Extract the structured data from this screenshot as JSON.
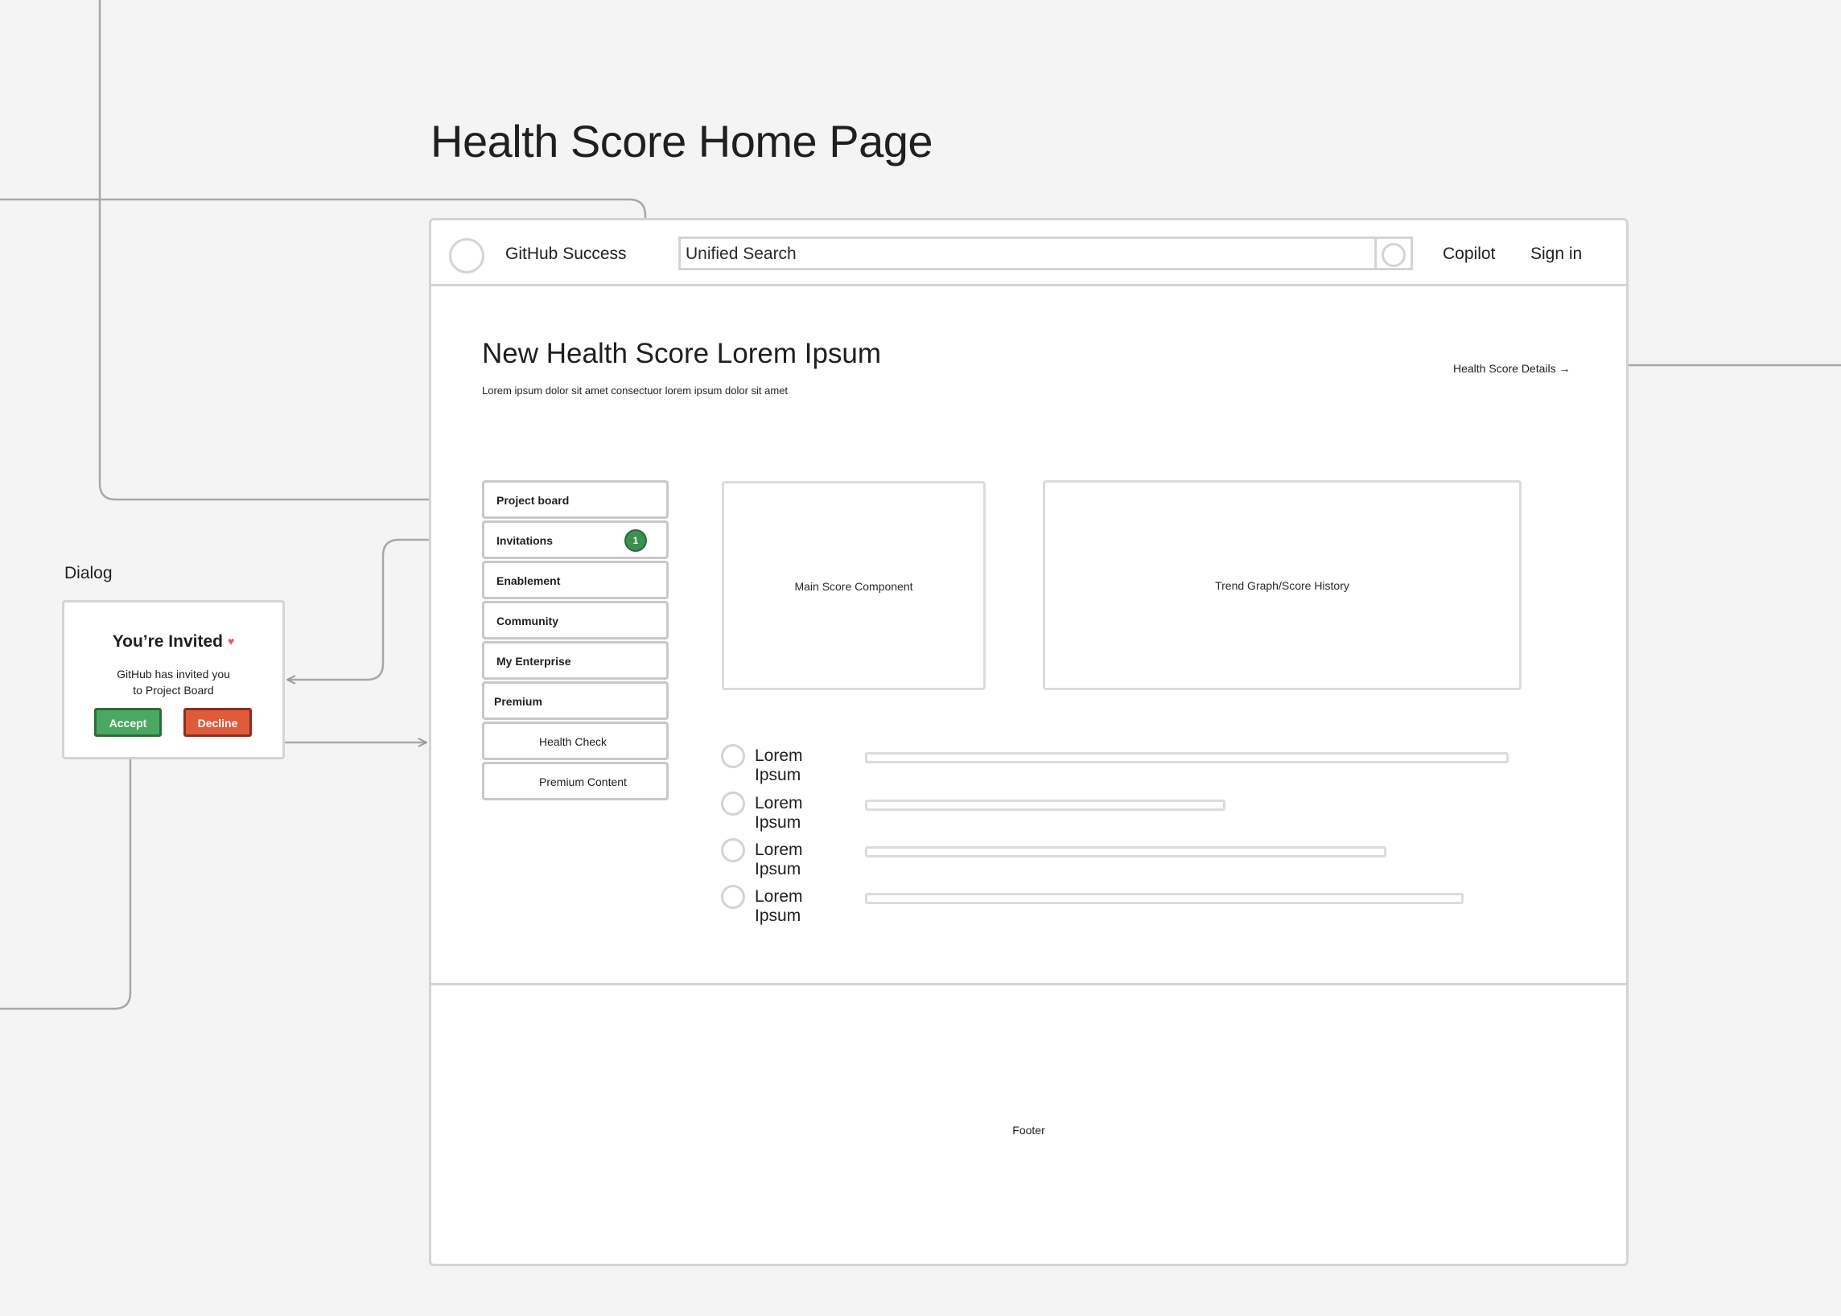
{
  "page_title": "Health Score Home Page",
  "header": {
    "brand": "GitHub Success",
    "search_text": "Unified Search",
    "copilot": "Copilot",
    "sign_in": "Sign in"
  },
  "hero": {
    "title": "New Health Score Lorem Ipsum",
    "subtitle": "Lorem ipsum dolor sit amet consectuor lorem ipsum dolor sit amet",
    "details_link": "Health Score Details →"
  },
  "sidebar": {
    "items": [
      {
        "label": "Project board"
      },
      {
        "label": "Invitations",
        "badge": "1"
      },
      {
        "label": "Enablement"
      },
      {
        "label": "Community"
      },
      {
        "label": "My Enterprise"
      },
      {
        "label": "Premium"
      },
      {
        "label": "Health Check"
      },
      {
        "label": "Premium Content"
      }
    ]
  },
  "cards": {
    "main_score": "Main Score Component",
    "trend_graph": "Trend Graph/Score History"
  },
  "list": [
    {
      "label": "Lorem Ipsum",
      "fill": 1.0
    },
    {
      "label": "Lorem Ipsum",
      "fill": 0.56
    },
    {
      "label": "Lorem Ipsum",
      "fill": 0.81
    },
    {
      "label": "Lorem Ipsum",
      "fill": 0.93
    }
  ],
  "footer": {
    "label": "Footer"
  },
  "dialog": {
    "caption": "Dialog",
    "title": "You’re Invited",
    "body_line1": "GitHub has invited you",
    "body_line2": "to Project Board",
    "accept": "Accept",
    "decline": "Decline"
  },
  "colors": {
    "accept": "#4aa862",
    "decline": "#e05a3c",
    "badge": "#3d8f4f",
    "border": "#d4d4d4",
    "background": "#f4f4f4"
  }
}
